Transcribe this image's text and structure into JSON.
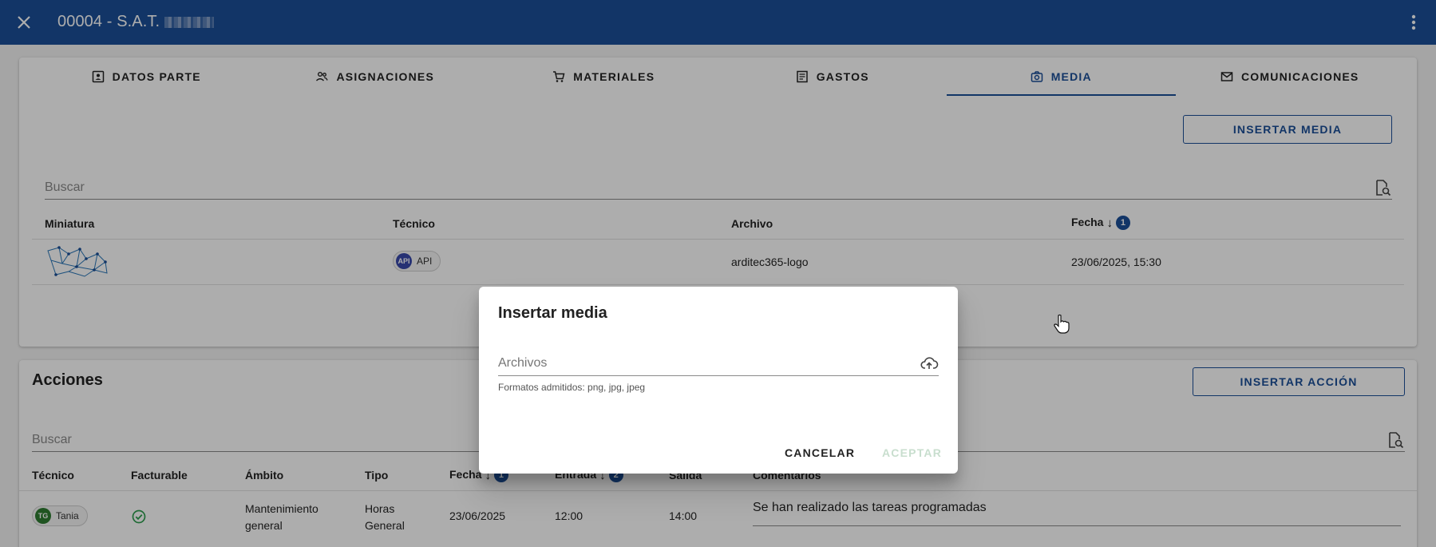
{
  "header": {
    "title": "00004 - S.A.T.",
    "close_icon": "close-icon",
    "menu_icon": "more-vert-icon"
  },
  "tabs": [
    {
      "label": "DATOS PARTE",
      "icon": "contact-card-icon"
    },
    {
      "label": "ASIGNACIONES",
      "icon": "people-icon"
    },
    {
      "label": "MATERIALES",
      "icon": "cart-icon"
    },
    {
      "label": "GASTOS",
      "icon": "receipt-icon"
    },
    {
      "label": "MEDIA",
      "icon": "camera-icon",
      "active": true
    },
    {
      "label": "COMUNICACIONES",
      "icon": "mail-icon"
    }
  ],
  "media": {
    "insert_button": "INSERTAR MEDIA",
    "search_placeholder": "Buscar",
    "columns": {
      "thumb": "Miniatura",
      "tech": "Técnico",
      "file": "Archivo",
      "date": "Fecha",
      "date_sort_badge": "1"
    },
    "rows": [
      {
        "tech_avatar": "API",
        "tech": "API",
        "file": "arditec365-logo",
        "date": "23/06/2025, 15:30"
      }
    ]
  },
  "actions": {
    "title": "Acciones",
    "insert_button": "INSERTAR ACCIÓN",
    "search_placeholder": "Buscar",
    "columns": {
      "tech": "Técnico",
      "billable": "Facturable",
      "scope": "Ámbito",
      "type": "Tipo",
      "date": "Fecha",
      "date_badge": "1",
      "entry": "Entrada",
      "entry_badge": "2",
      "exit": "Salida",
      "comments": "Comentarios"
    },
    "rows": [
      {
        "tech_avatar": "TG",
        "tech": "Tania",
        "scope_1": "Mantenimiento",
        "scope_2": "general",
        "type_1": "Horas",
        "type_2": "General",
        "date": "23/06/2025",
        "entry": "12:00",
        "exit": "14:00",
        "comment": "Se han realizado las tareas programadas"
      }
    ]
  },
  "dialog": {
    "title": "Insertar media",
    "field_label": "Archivos",
    "hint": "Formatos admitidos: png, jpg, jpeg",
    "cancel": "CANCELAR",
    "accept": "ACEPTAR"
  },
  "colors": {
    "primary": "#1b4f98",
    "api_avatar": "#3949ab",
    "tg_avatar": "#2e7d32",
    "check": "#2e9e4f",
    "accept_disabled": "#c8dece"
  }
}
